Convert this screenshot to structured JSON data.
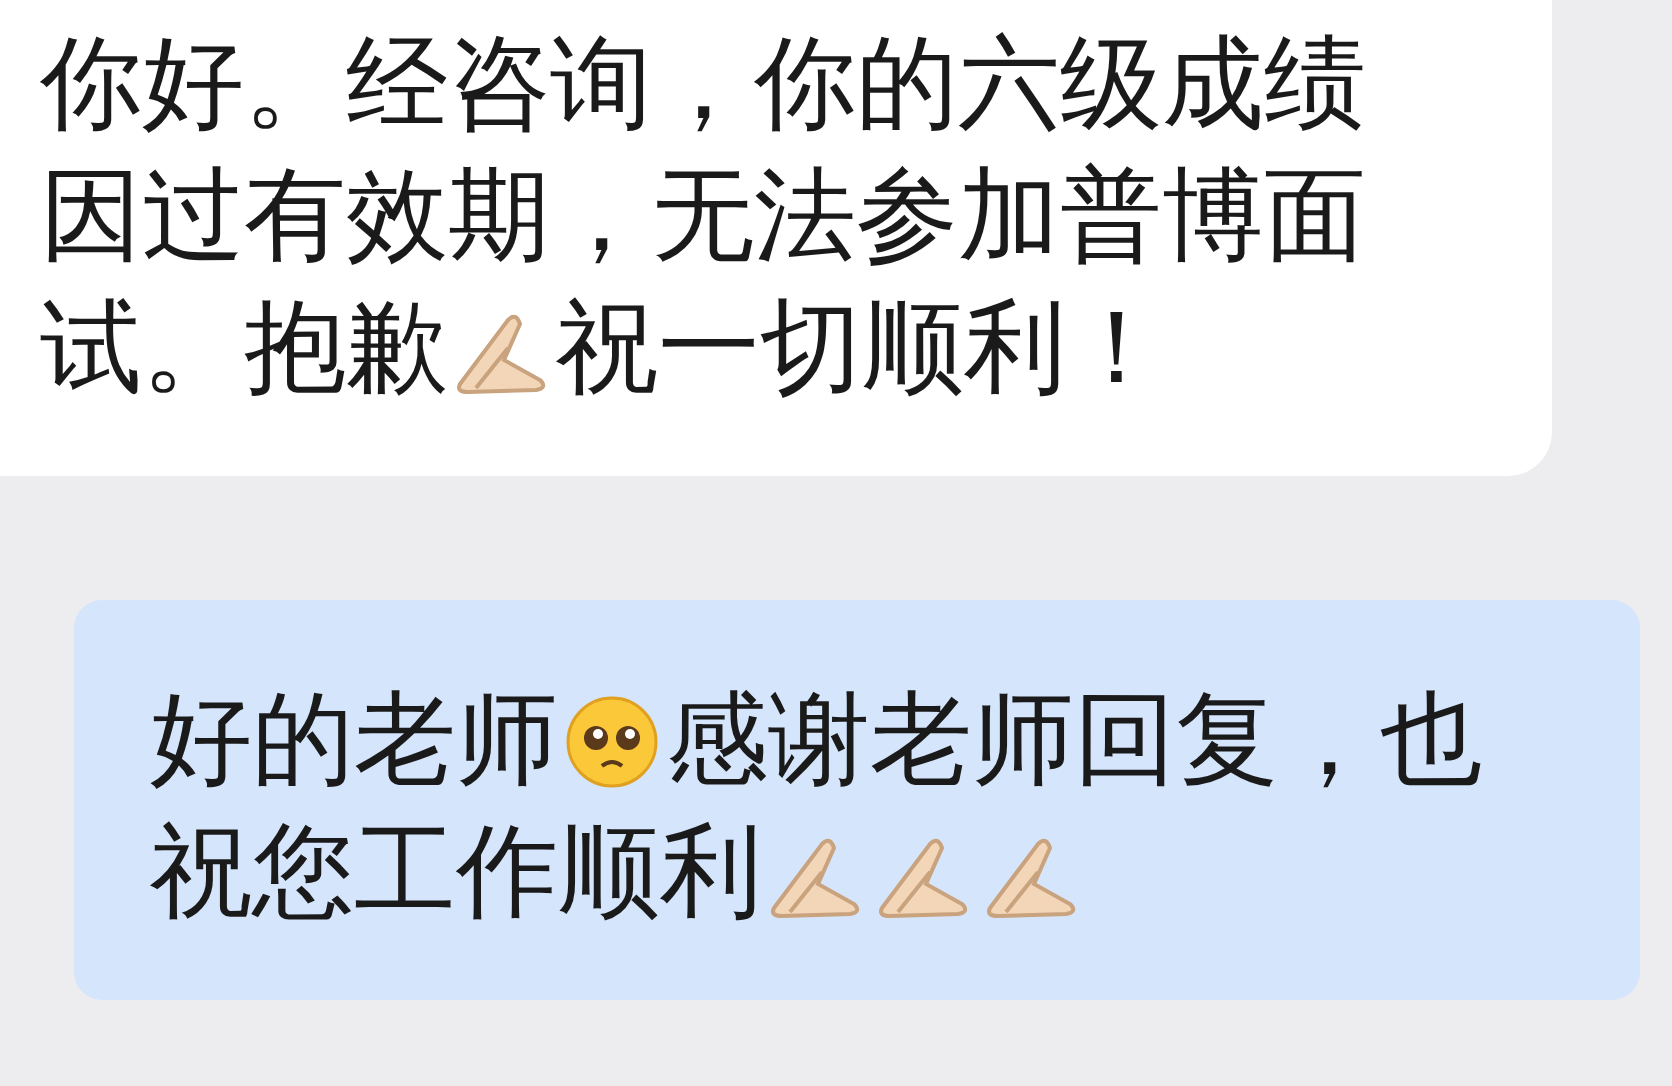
{
  "messages": [
    {
      "kind": "incoming",
      "lines": [
        [
          {
            "kind": "text",
            "text": "你好。经咨询，你的六级成绩"
          }
        ],
        [
          {
            "kind": "text",
            "text": "因过有效期，无法参加普博面"
          }
        ],
        [
          {
            "kind": "text",
            "text": "试。抱歉"
          },
          {
            "kind": "folded-hands"
          },
          {
            "kind": "text",
            "text": "祝一切顺利！"
          }
        ]
      ]
    },
    {
      "kind": "outgoing",
      "lines": [
        [
          {
            "kind": "text",
            "text": "好的老师"
          },
          {
            "kind": "pleading-face"
          },
          {
            "kind": "text",
            "text": "感谢老师回复，也"
          }
        ],
        [
          {
            "kind": "text",
            "text": "祝您工作顺利"
          },
          {
            "kind": "folded-hands"
          },
          {
            "kind": "folded-hands"
          },
          {
            "kind": "folded-hands"
          }
        ]
      ]
    }
  ]
}
